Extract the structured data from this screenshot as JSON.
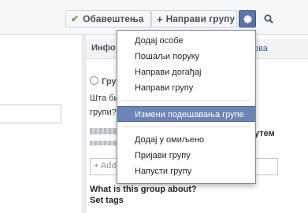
{
  "toolbar": {
    "notifications_label": "Обавештења",
    "create_group_label": "Направи групу"
  },
  "tabs": {
    "info_label": "Инфо",
    "right_link": "нова"
  },
  "group": {
    "heading": "Гру",
    "description_line1": "Шта би",
    "description_line2": "групи?",
    "side_label": "утем",
    "add_placeholder": "+ Add",
    "about_heading": "What is this group about?",
    "set_tags": "Set tags"
  },
  "menu": {
    "items": [
      {
        "label": "Додај особе"
      },
      {
        "label": "Пошаљи поруку"
      },
      {
        "label": "Направи догађај"
      },
      {
        "label": "Направи групу"
      },
      {
        "label": "Измени подешавања групе",
        "highlighted": true
      },
      {
        "label": "Додај у омиљено"
      },
      {
        "label": "Пријави групу"
      },
      {
        "label": "Напусти групу"
      }
    ]
  },
  "colors": {
    "accent": "#5b74a8",
    "menu_highlight": "#6d84b4",
    "link": "#3b5998"
  },
  "icons": [
    "check-icon",
    "plus-icon",
    "gear-icon",
    "search-icon",
    "lock-icon"
  ]
}
